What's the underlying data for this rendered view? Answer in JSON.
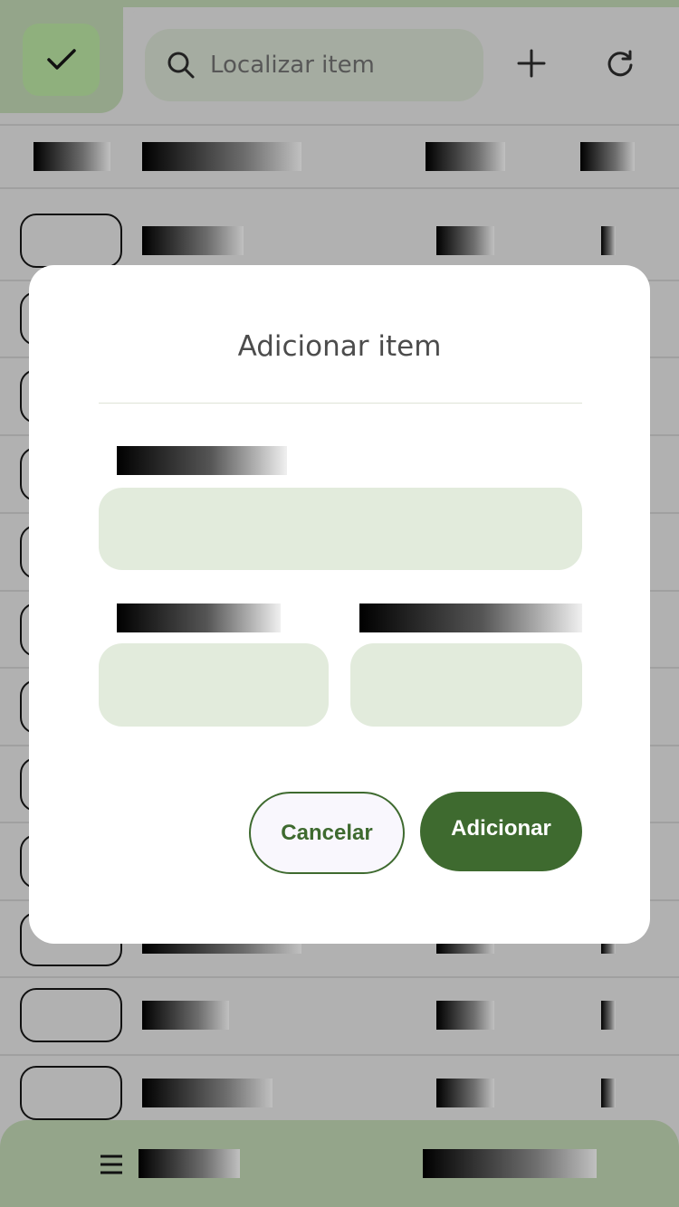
{
  "search": {
    "placeholder": "Localizar item"
  },
  "toolbar": {
    "confirm_icon": "check-icon",
    "search_icon": "search-icon",
    "add_icon": "plus-icon",
    "refresh_icon": "refresh-icon"
  },
  "bottom_bar": {
    "menu_icon": "menu-icon"
  },
  "dialog": {
    "title": "Adicionar item",
    "cancel_label": "Cancelar",
    "submit_label": "Adicionar"
  },
  "colors": {
    "accent": "#3e6a2f",
    "field_bg": "#e2ebdc",
    "tile_green": "#8fb07d",
    "header_green": "#94a58a",
    "scrim": "#b1b1b1"
  }
}
